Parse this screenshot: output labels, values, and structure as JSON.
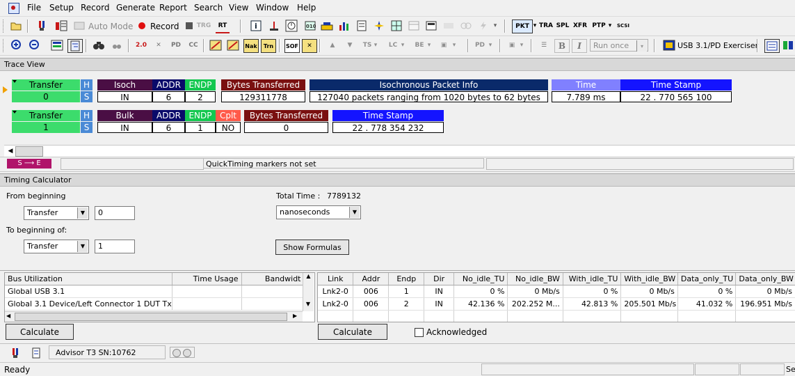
{
  "menu": [
    "File",
    "Setup",
    "Record",
    "Generate",
    "Report",
    "Search",
    "View",
    "Window",
    "Help"
  ],
  "toolbar1": {
    "automode_label": "Auto Mode",
    "record_label": "Record",
    "rt_label": "RT",
    "pkt": "PKT",
    "tra": "TRA",
    "spl": "SPL",
    "xfr": "XFR",
    "ptp": "PTP",
    "scsi": "SCSI"
  },
  "toolbar2": {
    "run_once": "Run once",
    "exerciser": "USB 3.1/PD Exerciser"
  },
  "trace_view": {
    "title": "Trace View",
    "row1": {
      "transfer_label": "Transfer",
      "transfer_num": "0",
      "h": "H",
      "s": "S",
      "type_label": "Isoch",
      "type_val": "IN",
      "addr_label": "ADDR",
      "addr_val": "6",
      "endp_label": "ENDP",
      "endp_val": "2",
      "bytes_label": "Bytes Transferred",
      "bytes_val": "129311778",
      "iso_label": "Isochronous Packet Info",
      "iso_val": "127040 packets ranging from 1020 bytes to 62 bytes",
      "time_label": "Time",
      "time_val": "7.789 ms",
      "ts_label": "Time Stamp",
      "ts_val": "22 . 770 565 100"
    },
    "row2": {
      "transfer_label": "Transfer",
      "transfer_num": "1",
      "h": "H",
      "s": "S",
      "type_label": "Bulk",
      "type_val": "IN",
      "addr_label": "ADDR",
      "addr_val": "6",
      "endp_label": "ENDP",
      "endp_val": "1",
      "cplt_label": "Cplt",
      "cplt_val": "NO",
      "bytes_label": "Bytes Transferred",
      "bytes_val": "0",
      "ts_label": "Time Stamp",
      "ts_val": "22 . 778 354 232"
    },
    "marker_label": "S ⟶ E",
    "quicktiming": "QuickTiming markers not set"
  },
  "timing": {
    "title": "Timing Calculator",
    "from_label": "From beginning",
    "from_select": "Transfer",
    "from_value": "0",
    "to_label": "To beginning of:",
    "to_select": "Transfer",
    "to_value": "1",
    "total_label": "Total Time :",
    "total_value": "7789132",
    "units": "nanoseconds",
    "show_formulas": "Show Formulas"
  },
  "bus_util": {
    "headers": [
      "Bus Utilization",
      "Time Usage",
      "Bandwidt"
    ],
    "rows": [
      [
        "Global USB 3.1",
        "",
        ""
      ],
      [
        "Global 3.1 Device/Left Connector 1 DUT Tx",
        "",
        ""
      ]
    ],
    "calculate": "Calculate"
  },
  "link_table": {
    "headers": [
      "Link",
      "Addr",
      "Endp",
      "Dir",
      "No_idle_TU",
      "No_idle_BW",
      "With_idle_TU",
      "With_idle_BW",
      "Data_only_TU",
      "Data_only_BW"
    ],
    "rows": [
      [
        "Lnk2-0",
        "006",
        "1",
        "IN",
        "0 %",
        "0 Mb/s",
        "0 %",
        "0 Mb/s",
        "0 %",
        "0 Mb/s"
      ],
      [
        "Lnk2-0",
        "006",
        "2",
        "IN",
        "42.136 %",
        "202.252 M...",
        "42.813 %",
        "205.501 Mb/s",
        "41.032 %",
        "196.951 Mb/s"
      ]
    ],
    "calculate": "Calculate",
    "acknowledged": "Acknowledged"
  },
  "statusbar": {
    "device": "Advisor T3 SN:10762",
    "ready": "Ready",
    "right_tail": "Se"
  }
}
